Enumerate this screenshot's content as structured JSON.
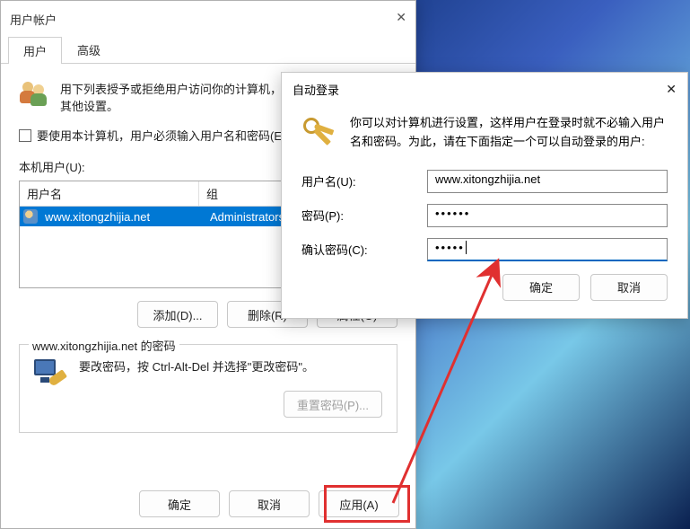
{
  "useracct": {
    "title": "用户帐户",
    "tabs": {
      "users": "用户",
      "advanced": "高级"
    },
    "intro": "用下列表授予或拒绝用户访问你的计算机，还可以更改其密码和其他设置。",
    "require_pw": "要使用本计算机，用户必须输入用户名和密码(E)",
    "local_users": "本机用户(U):",
    "grid": {
      "col_name": "用户名",
      "col_group": "组",
      "row": {
        "name": "www.xitongzhijia.net",
        "group": "Administrators"
      }
    },
    "btn_add": "添加(D)...",
    "btn_delete": "删除(R)",
    "btn_props": "属性(O)",
    "pw_section_title": "www.xitongzhijia.net 的密码",
    "pw_hint": "要改密码，按 Ctrl-Alt-Del 并选择\"更改密码\"。",
    "btn_reset": "重置密码(P)...",
    "btn_ok": "确定",
    "btn_cancel": "取消",
    "btn_apply": "应用(A)"
  },
  "auto": {
    "title": "自动登录",
    "intro": "你可以对计算机进行设置，这样用户在登录时就不必输入用户名和密码。为此，请在下面指定一个可以自动登录的用户:",
    "lbl_user": "用户名(U):",
    "val_user": "www.xitongzhijia.net",
    "lbl_pw": "密码(P):",
    "val_pw": "••••••",
    "lbl_confirm": "确认密码(C):",
    "val_confirm": "•••••",
    "btn_ok": "确定",
    "btn_cancel": "取消"
  }
}
